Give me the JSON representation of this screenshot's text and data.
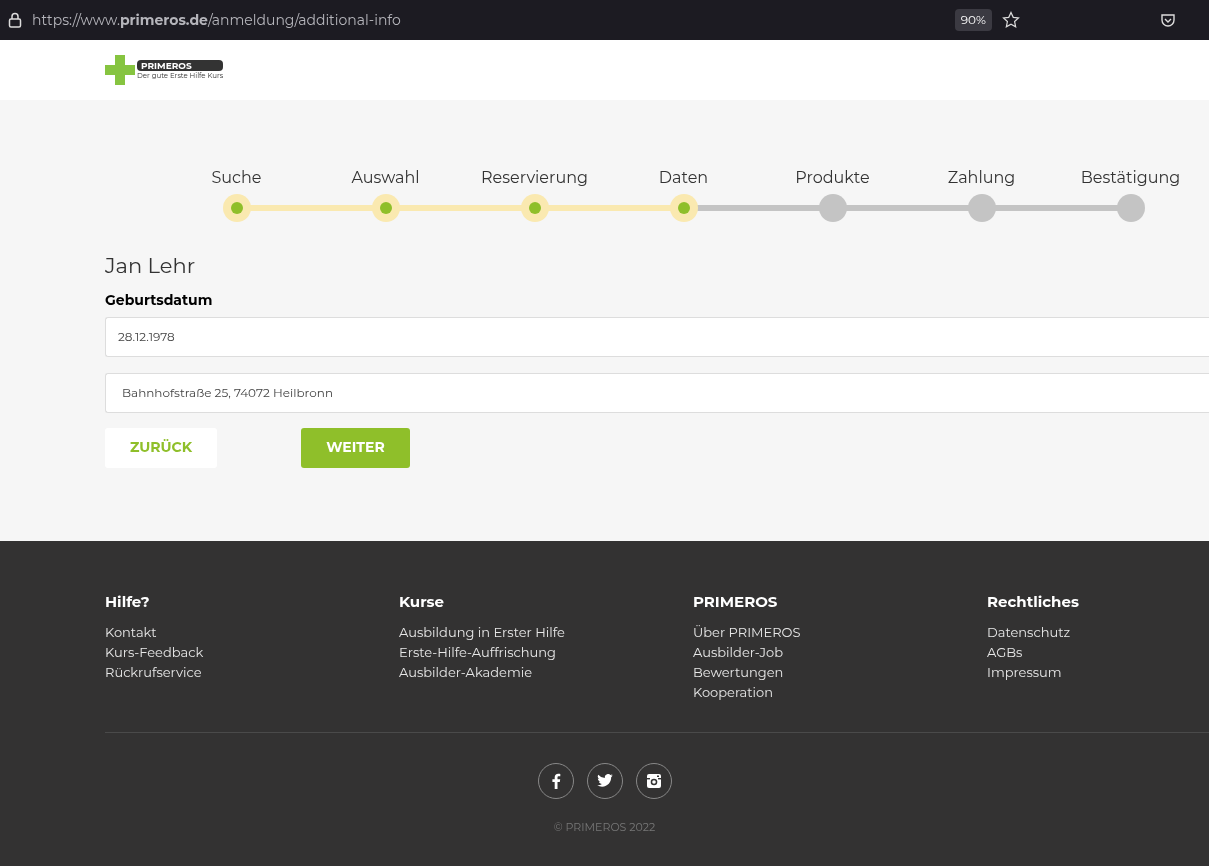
{
  "browser": {
    "url": "https://www.**primeros.de**/anmeldung/additional-info",
    "zoom": "90%"
  },
  "logo": {
    "name": "PRIMEROS",
    "tagline": "Der gute Erste Hilfe Kurs"
  },
  "steps": [
    {
      "label": "Suche",
      "done": true
    },
    {
      "label": "Auswahl",
      "done": true
    },
    {
      "label": "Reservierung",
      "done": true
    },
    {
      "label": "Daten",
      "done": true
    },
    {
      "label": "Produkte",
      "done": false
    },
    {
      "label": "Zahlung",
      "done": false
    },
    {
      "label": "Bestätigung",
      "done": false
    }
  ],
  "person": {
    "name": "Jan Lehr"
  },
  "birthdate": {
    "label": "Geburtsdatum",
    "value": "28.12.1978"
  },
  "address": {
    "value": "Bahnhofstraße 25, 74072 Heilbronn"
  },
  "buttons": {
    "back": "ZURÜCK",
    "next": "WEITER"
  },
  "footer": {
    "columns": [
      {
        "title": "Hilfe?",
        "links": [
          "Kontakt",
          "Kurs-Feedback",
          "Rückrufservice"
        ]
      },
      {
        "title": "Kurse",
        "links": [
          "Ausbildung in Erster Hilfe",
          "Erste-Hilfe-Auffrischung",
          "Ausbilder-Akademie"
        ]
      },
      {
        "title": "PRIMEROS",
        "links": [
          "Über PRIMEROS",
          "Ausbilder-Job",
          "Bewertungen",
          "Kooperation"
        ]
      },
      {
        "title": "Rechtliches",
        "links": [
          "Datenschutz",
          "AGBs",
          "Impressum"
        ]
      }
    ],
    "social": [
      {
        "kind": "facebook"
      },
      {
        "kind": "twitter"
      },
      {
        "kind": "instagram"
      }
    ],
    "copyright": "© PRIMEROS 2022"
  }
}
